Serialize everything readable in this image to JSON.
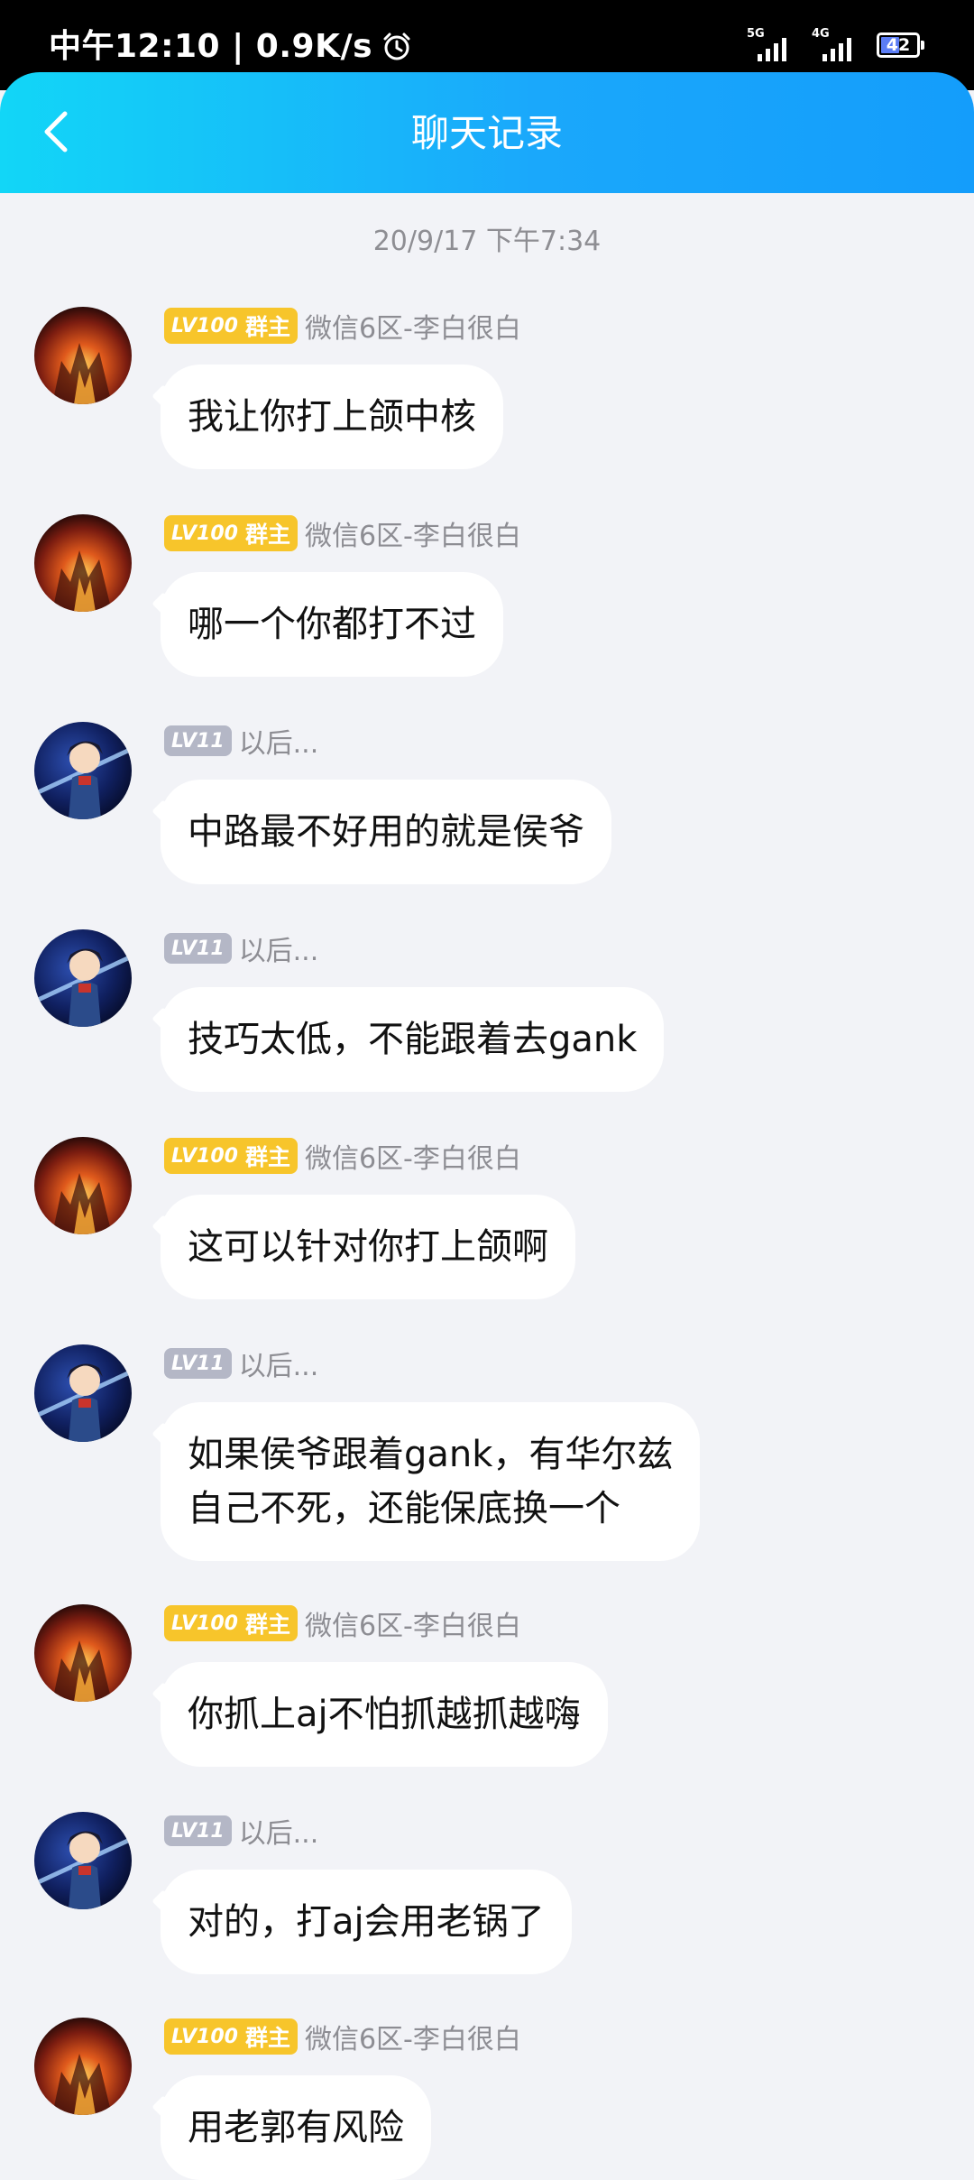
{
  "status_bar": {
    "time": "中午12:10 | 0.9K/s",
    "net1": "5G",
    "net2": "4G",
    "battery": "42"
  },
  "header": {
    "title": "聊天记录"
  },
  "timestamp": "20/9/17 下午7:34",
  "messages": [
    {
      "role": "owner",
      "lv": "LV100",
      "badge": "群主",
      "name": "微信6区-李白很白",
      "text": "我让你打上颌中核"
    },
    {
      "role": "owner",
      "lv": "LV100",
      "badge": "群主",
      "name": "微信6区-李白很白",
      "text": "哪一个你都打不过"
    },
    {
      "role": "member",
      "lv": "LV11",
      "badge": "",
      "name": "以后...",
      "text": "中路最不好用的就是侯爷"
    },
    {
      "role": "member",
      "lv": "LV11",
      "badge": "",
      "name": "以后...",
      "text": "技巧太低，不能跟着去gank"
    },
    {
      "role": "owner",
      "lv": "LV100",
      "badge": "群主",
      "name": "微信6区-李白很白",
      "text": "这可以针对你打上颌啊"
    },
    {
      "role": "member",
      "lv": "LV11",
      "badge": "",
      "name": "以后...",
      "text": "如果侯爷跟着gank，有华尔兹",
      "text2": "自己不死，还能保底换一个"
    },
    {
      "role": "owner",
      "lv": "LV100",
      "badge": "群主",
      "name": "微信6区-李白很白",
      "text": "你抓上aj不怕抓越抓越嗨"
    },
    {
      "role": "member",
      "lv": "LV11",
      "badge": "",
      "name": "以后...",
      "text": "对的，打aj会用老锅了"
    },
    {
      "role": "owner",
      "lv": "LV100",
      "badge": "群主",
      "name": "微信6区-李白很白",
      "text": "用老郭有风险"
    }
  ],
  "colors": {
    "header_start": "#12d6f7",
    "header_end": "#149dfb",
    "owner_badge": "#f7c52b",
    "member_badge": "#b4b7c6",
    "background": "#f2f3f7"
  },
  "icons": {
    "back": "back-chevron-icon",
    "alarm": "alarm-clock-icon",
    "owner_avatar": "fire-scene-avatar",
    "member_avatar": "anime-boy-avatar"
  }
}
